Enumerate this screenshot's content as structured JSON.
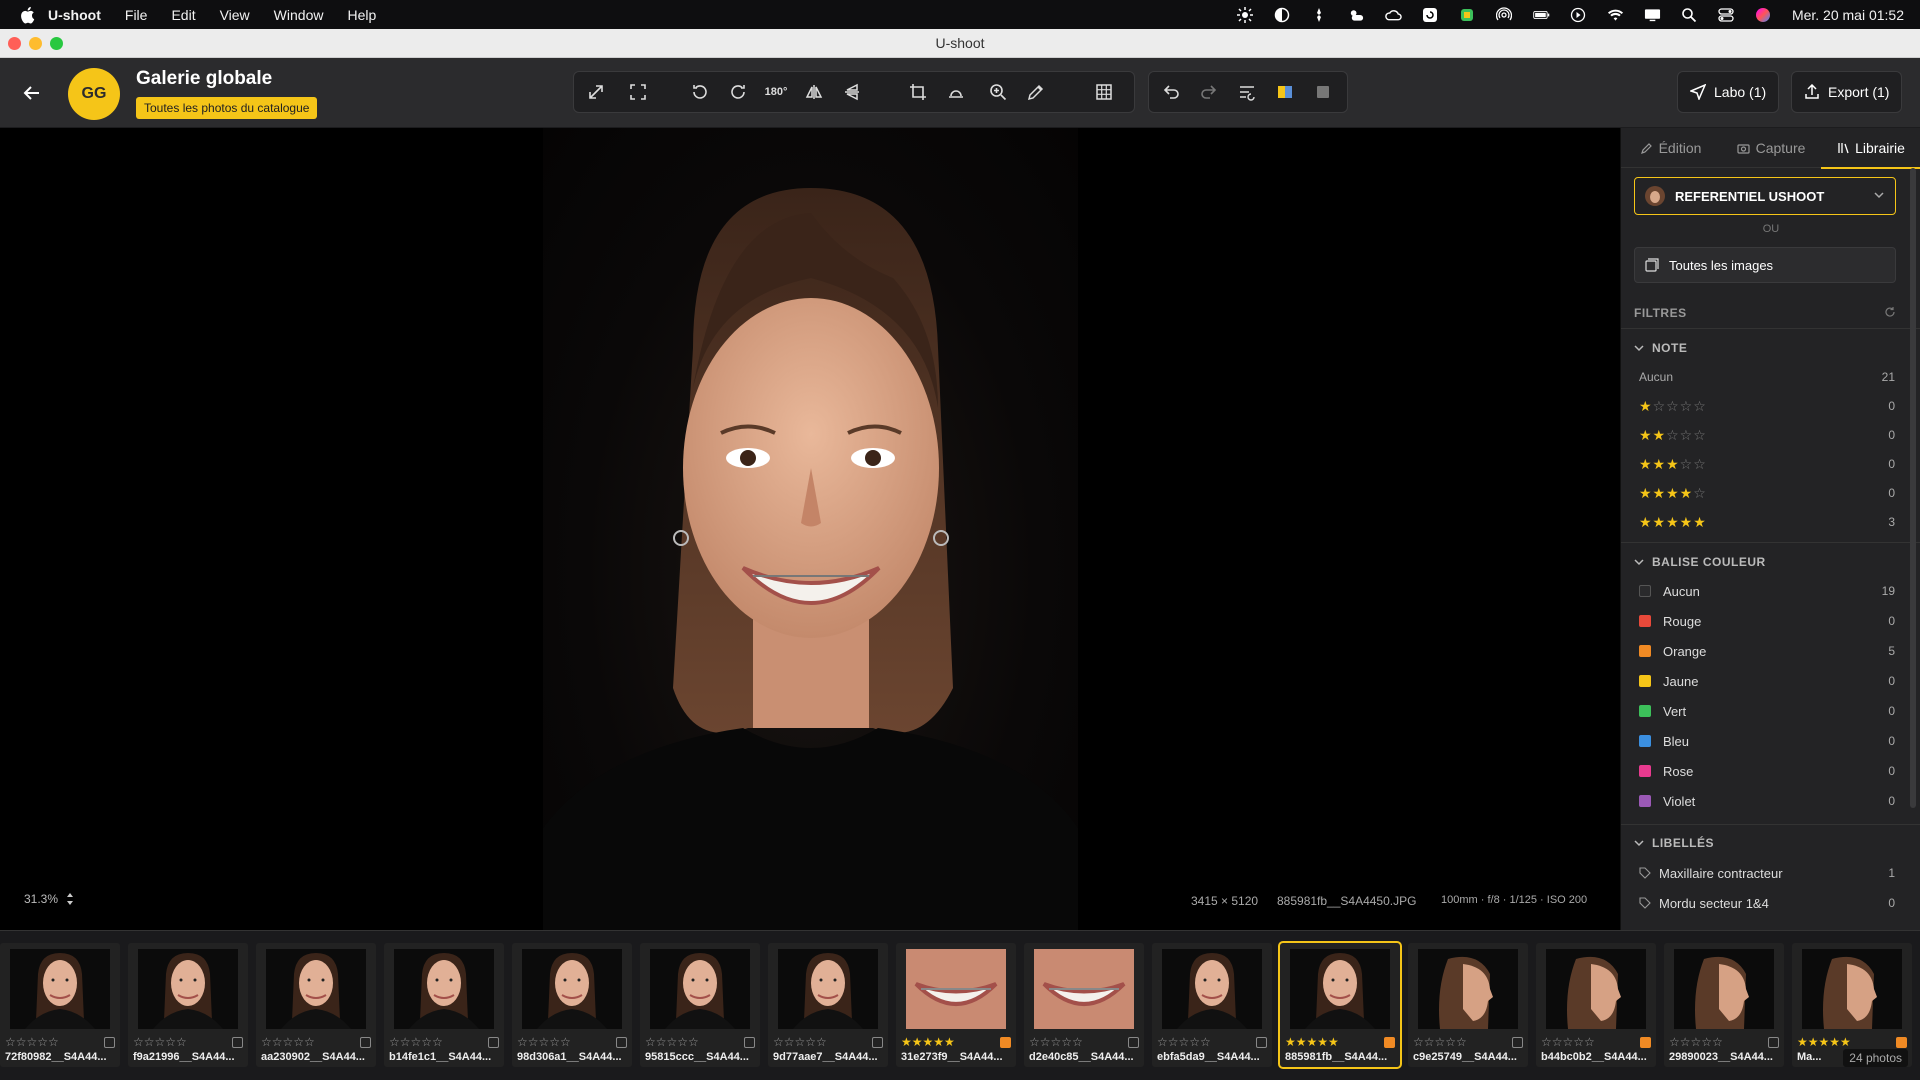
{
  "menubar": {
    "app_name": "U-shoot",
    "items": [
      "File",
      "Edit",
      "View",
      "Window",
      "Help"
    ],
    "clock": "Mer. 20 mai  01:52"
  },
  "window": {
    "title": "U-shoot"
  },
  "header": {
    "avatar_initials": "GG",
    "title": "Galerie globale",
    "badge": "Toutes les photos du catalogue"
  },
  "toolbar": {
    "labo_label": "Labo (1)",
    "export_label": "Export (1)",
    "rotate180_label": "180°"
  },
  "viewer": {
    "zoom": "31.3%",
    "dimensions": "3415 × 5120",
    "filename": "885981fb__S4A4450.JPG",
    "exif": "100mm · f/8 · 1/125 · ISO 200"
  },
  "sidebar": {
    "tabs": [
      "Édition",
      "Capture",
      "Librairie"
    ],
    "referentiel": "REFERENTIEL USHOOT",
    "ou": "OU",
    "all_images": "Toutes les images",
    "filters_title": "FILTRES",
    "note": {
      "title": "NOTE",
      "aucun_label": "Aucun",
      "aucun_count": "21",
      "ratings": [
        {
          "stars": 1,
          "count": "0"
        },
        {
          "stars": 2,
          "count": "0"
        },
        {
          "stars": 3,
          "count": "0"
        },
        {
          "stars": 4,
          "count": "0"
        },
        {
          "stars": 5,
          "count": "3"
        }
      ]
    },
    "color": {
      "title": "BALISE COULEUR",
      "items": [
        {
          "label": "Aucun",
          "count": "19",
          "color": "#2a2a2c"
        },
        {
          "label": "Rouge",
          "count": "0",
          "color": "#e8493a"
        },
        {
          "label": "Orange",
          "count": "5",
          "color": "#f08a24"
        },
        {
          "label": "Jaune",
          "count": "0",
          "color": "#f5c518"
        },
        {
          "label": "Vert",
          "count": "0",
          "color": "#3cc05a"
        },
        {
          "label": "Bleu",
          "count": "0",
          "color": "#3b8fe0"
        },
        {
          "label": "Rose",
          "count": "0",
          "color": "#e83a8f"
        },
        {
          "label": "Violet",
          "count": "0",
          "color": "#9b59b6"
        }
      ]
    },
    "labels": {
      "title": "LIBELLÉS",
      "items": [
        {
          "label": "Maxillaire contracteur",
          "count": "1"
        },
        {
          "label": "Mordu secteur 1&4",
          "count": "0"
        }
      ]
    }
  },
  "filmstrip": {
    "thumbs": [
      {
        "name": "72f80982__S4A44...",
        "rating": 0,
        "tag": "none",
        "kind": "face"
      },
      {
        "name": "f9a21996__S4A44...",
        "rating": 0,
        "tag": "none",
        "kind": "face"
      },
      {
        "name": "aa230902__S4A44...",
        "rating": 0,
        "tag": "none",
        "kind": "face"
      },
      {
        "name": "b14fe1c1__S4A44...",
        "rating": 0,
        "tag": "none",
        "kind": "face"
      },
      {
        "name": "98d306a1__S4A44...",
        "rating": 0,
        "tag": "none",
        "kind": "face"
      },
      {
        "name": "95815ccc__S4A44...",
        "rating": 0,
        "tag": "none",
        "kind": "face"
      },
      {
        "name": "9d77aae7__S4A44...",
        "rating": 0,
        "tag": "none",
        "kind": "face"
      },
      {
        "name": "31e273f9__S4A44...",
        "rating": 5,
        "tag": "orange",
        "kind": "mouth"
      },
      {
        "name": "d2e40c85__S4A44...",
        "rating": 0,
        "tag": "none",
        "kind": "mouth"
      },
      {
        "name": "ebfa5da9__S4A44...",
        "rating": 0,
        "tag": "none",
        "kind": "face"
      },
      {
        "name": "885981fb__S4A44...",
        "rating": 5,
        "tag": "orange",
        "kind": "face",
        "selected": true
      },
      {
        "name": "c9e25749__S4A44...",
        "rating": 0,
        "tag": "none",
        "kind": "profile"
      },
      {
        "name": "b44bc0b2__S4A44...",
        "rating": 0,
        "tag": "orange",
        "kind": "profile"
      },
      {
        "name": "29890023__S4A44...",
        "rating": 0,
        "tag": "none",
        "kind": "profile"
      },
      {
        "name": "Ma...",
        "rating": 5,
        "tag": "orange",
        "kind": "profile"
      }
    ],
    "count": "24 photos"
  }
}
